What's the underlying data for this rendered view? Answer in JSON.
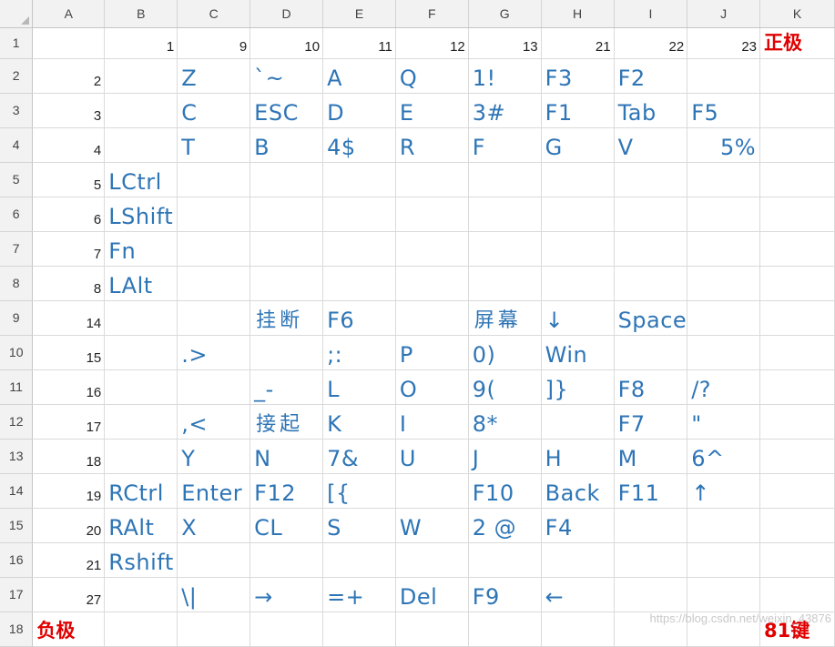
{
  "columns": [
    "A",
    "B",
    "C",
    "D",
    "E",
    "F",
    "G",
    "H",
    "I",
    "J",
    "K"
  ],
  "rows": [
    {
      "n": "1",
      "cells": [
        "",
        "1",
        "9",
        "10",
        "11",
        "12",
        "13",
        "21",
        "22",
        "23",
        ""
      ],
      "label_k": "正极"
    },
    {
      "n": "2",
      "cells": [
        "2",
        "",
        "Z",
        "`~",
        "A",
        "Q",
        "1!",
        "F3",
        "F2",
        "",
        ""
      ]
    },
    {
      "n": "3",
      "cells": [
        "3",
        "",
        "C",
        "ESC",
        "D",
        "E",
        "3#",
        "F1",
        "Tab",
        "F5",
        ""
      ]
    },
    {
      "n": "4",
      "cells": [
        "4",
        "",
        "T",
        "B",
        "4$",
        "R",
        "F",
        "G",
        "V",
        "5%",
        ""
      ]
    },
    {
      "n": "5",
      "cells": [
        "5",
        "LCtrl",
        "",
        "",
        "",
        "",
        "",
        "",
        "",
        "",
        ""
      ]
    },
    {
      "n": "6",
      "cells": [
        "6",
        "LShift",
        "",
        "",
        "",
        "",
        "",
        "",
        "",
        "",
        ""
      ]
    },
    {
      "n": "7",
      "cells": [
        "7",
        "Fn",
        "",
        "",
        "",
        "",
        "",
        "",
        "",
        "",
        ""
      ]
    },
    {
      "n": "8",
      "cells": [
        "8",
        "LAlt",
        "",
        "",
        "",
        "",
        "",
        "",
        "",
        "",
        ""
      ]
    },
    {
      "n": "9",
      "cells": [
        "14",
        "",
        "",
        "挂断",
        "F6",
        "",
        "屏幕",
        "↓",
        "Space",
        "",
        ""
      ]
    },
    {
      "n": "10",
      "cells": [
        "15",
        "",
        ".>",
        "",
        ";:",
        "P",
        "0)",
        "Win",
        "",
        "",
        ""
      ]
    },
    {
      "n": "11",
      "cells": [
        "16",
        "",
        "",
        "_-",
        "L",
        "O",
        "9(",
        "]}",
        "F8",
        "/?",
        ""
      ]
    },
    {
      "n": "12",
      "cells": [
        "17",
        "",
        ",<",
        "接起",
        "K",
        "I",
        "8*",
        "",
        "F7",
        "\"",
        ""
      ]
    },
    {
      "n": "13",
      "cells": [
        "18",
        "",
        "Y",
        "N",
        "7&",
        "U",
        "J",
        "H",
        "M",
        "6^",
        ""
      ]
    },
    {
      "n": "14",
      "cells": [
        "19",
        "RCtrl",
        "Enter",
        "F12",
        "[{",
        "",
        "F10",
        "Back",
        "F11",
        "↑",
        ""
      ]
    },
    {
      "n": "15",
      "cells": [
        "20",
        "RAlt",
        "X",
        "CL",
        "S",
        "W",
        "2 @",
        "F4",
        "",
        "",
        ""
      ]
    },
    {
      "n": "16",
      "cells": [
        "21",
        "Rshift",
        "",
        "",
        "",
        "",
        "",
        "",
        "",
        "",
        ""
      ]
    },
    {
      "n": "17",
      "cells": [
        "27",
        "",
        "\\|",
        "→",
        "=+",
        "Del",
        "F9",
        "←",
        "",
        "",
        ""
      ]
    },
    {
      "n": "18",
      "cells": [
        "",
        "",
        "",
        "",
        "",
        "",
        "",
        "",
        "",
        "",
        ""
      ],
      "label_a": "负极",
      "label_k": "81键"
    }
  ],
  "watermark": "https://blog.csdn.net/weixin_43876",
  "colors": {
    "key_text": "#2e75b6",
    "label_red": "#e00000",
    "header_bg": "#f2f2f2",
    "gridline": "#dadada"
  }
}
